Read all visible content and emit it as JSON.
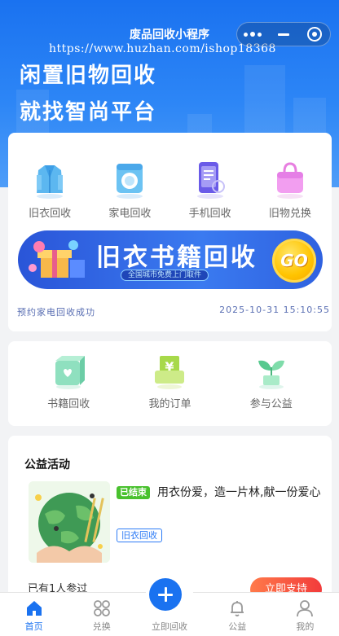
{
  "nav": {
    "title": "废品回收小程序",
    "watermark": "https://www.huzhan.com/ishop18368"
  },
  "hero": {
    "slogan_line1": "闲置旧物回收",
    "slogan_line2": "就找智尚平台"
  },
  "categories": [
    {
      "label": "旧衣回收",
      "icon": "clothing-icon"
    },
    {
      "label": "家电回收",
      "icon": "washing-machine-icon"
    },
    {
      "label": "手机回收",
      "icon": "phone-icon"
    },
    {
      "label": "旧物兑换",
      "icon": "shopping-bag-icon"
    }
  ],
  "banner": {
    "title": "旧衣书籍回收",
    "subtitle": "全国城市免费上门取件",
    "go_label": "GO"
  },
  "notice": {
    "text": "预约家电回收成功",
    "time": "2025-10-31 15:10:55"
  },
  "services": [
    {
      "label": "书籍回收",
      "icon": "book-box-icon"
    },
    {
      "label": "我的订单",
      "icon": "order-yen-icon"
    },
    {
      "label": "参与公益",
      "icon": "sprout-icon"
    }
  ],
  "activity_section": {
    "title": "公益活动",
    "status": "已结束",
    "activity_title": "用衣份爱，造一片林,献一份爱心",
    "tag": "旧衣回收",
    "participants": "已有1人参过",
    "action": "立即支持"
  },
  "tabbar": [
    {
      "label": "首页",
      "icon": "home-icon",
      "active": true
    },
    {
      "label": "兑换",
      "icon": "exchange-icon",
      "active": false
    },
    {
      "label": "立即回收",
      "icon": "plus-icon",
      "active": false
    },
    {
      "label": "公益",
      "icon": "bell-icon",
      "active": false
    },
    {
      "label": "我的",
      "icon": "user-icon",
      "active": false
    }
  ],
  "colors": {
    "primary": "#1a72f0",
    "ended_tag": "#49c12e",
    "support_button": "#f23b3b",
    "notice_text": "#5a6fb3"
  }
}
